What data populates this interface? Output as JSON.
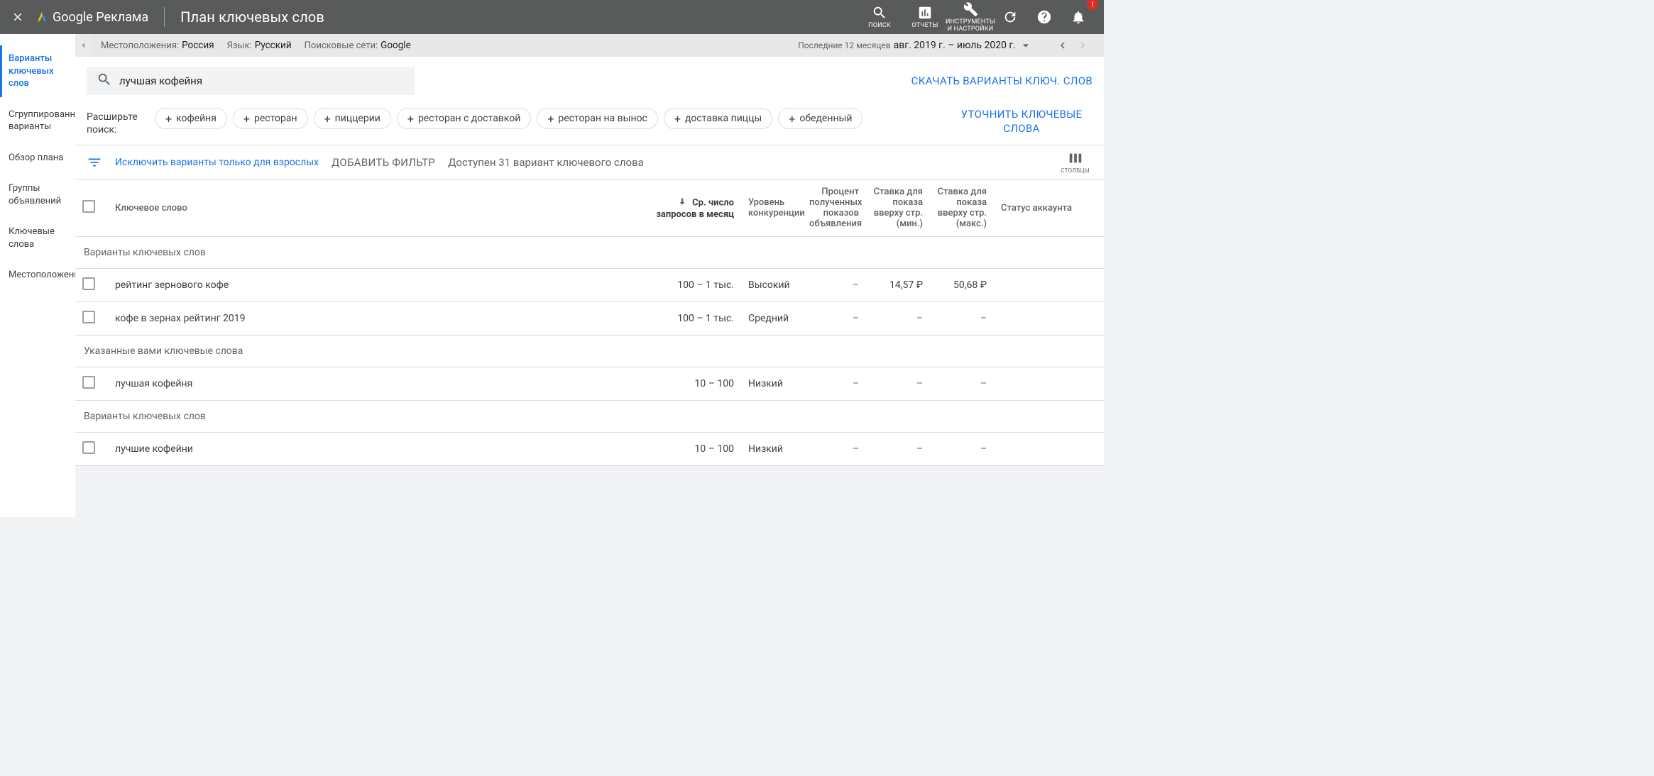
{
  "header": {
    "logo_text": "Google Реклама",
    "page_title": "План ключевых слов",
    "tools": {
      "search_label": "ПОИСК",
      "reports_label": "ОТЧЕТЫ",
      "tools_label": "ИНСТРУМЕНТЫ\nИ НАСТРОЙКИ"
    },
    "notification_badge": "!"
  },
  "sidebar": {
    "items": [
      {
        "label": "Варианты ключевых слов",
        "active": true
      },
      {
        "label": "Сгруппированные варианты",
        "active": false
      },
      {
        "label": "Обзор плана",
        "active": false
      },
      {
        "label": "Группы объявлений",
        "active": false
      },
      {
        "label": "Ключевые слова",
        "active": false
      },
      {
        "label": "Местоположения",
        "active": false
      }
    ]
  },
  "filters": {
    "location_label": "Местоположения:",
    "location_value": "Россия",
    "language_label": "Язык:",
    "language_value": "Русский",
    "networks_label": "Поисковые сети:",
    "networks_value": "Google",
    "date_preset_label": "Последние 12 месяцев",
    "date_value": "авг. 2019 г. – июль 2020 г."
  },
  "search": {
    "value": "лучшая кофейня",
    "download_label": "СКАЧАТЬ ВАРИАНТЫ КЛЮЧ. СЛОВ"
  },
  "chips": {
    "broaden_label": "Расширьте поиск:",
    "items": [
      "кофейня",
      "ресторан",
      "пиццерии",
      "ресторан с доставкой",
      "ресторан на вынос",
      "доставка пиццы",
      "обеденный"
    ],
    "refine_label": "УТОЧНИТЬ КЛЮЧЕВЫЕ СЛОВА"
  },
  "addfilter": {
    "adult_label": "Исключить варианты только для взрослых",
    "add_filter_label": "ДОБАВИТЬ ФИЛЬТР",
    "available_text": "Доступен 31 вариант ключевого слова",
    "columns_label": "СТОЛБЦЫ"
  },
  "table": {
    "columns": {
      "keyword": "Ключевое слово",
      "volume": "Ср. число запросов в месяц",
      "competition": "Уровень конкуренции",
      "impression_pct": "Процент полученных показов объявления",
      "bid_min": "Ставка для показа вверху стр. (мин.)",
      "bid_max": "Ставка для показа вверху стр. (макс.)",
      "account_status": "Статус аккаунта"
    },
    "groups": [
      {
        "title": "Варианты ключевых слов",
        "rows": [
          {
            "keyword": "рейтинг зернового кофе",
            "volume": "100 – 1 тыс.",
            "competition": "Высокий",
            "impression_pct": "–",
            "bid_min": "14,57 ₽",
            "bid_max": "50,68 ₽",
            "status": ""
          },
          {
            "keyword": "кофе в зернах рейтинг 2019",
            "volume": "100 – 1 тыс.",
            "competition": "Средний",
            "impression_pct": "–",
            "bid_min": "–",
            "bid_max": "–",
            "status": ""
          }
        ]
      },
      {
        "title": "Указанные вами ключевые слова",
        "rows": [
          {
            "keyword": "лучшая кофейня",
            "volume": "10 – 100",
            "competition": "Низкий",
            "impression_pct": "–",
            "bid_min": "–",
            "bid_max": "–",
            "status": ""
          }
        ]
      },
      {
        "title": "Варианты ключевых слов",
        "rows": [
          {
            "keyword": "лучшие кофейни",
            "volume": "10 – 100",
            "competition": "Низкий",
            "impression_pct": "–",
            "bid_min": "–",
            "bid_max": "–",
            "status": ""
          }
        ]
      }
    ]
  }
}
